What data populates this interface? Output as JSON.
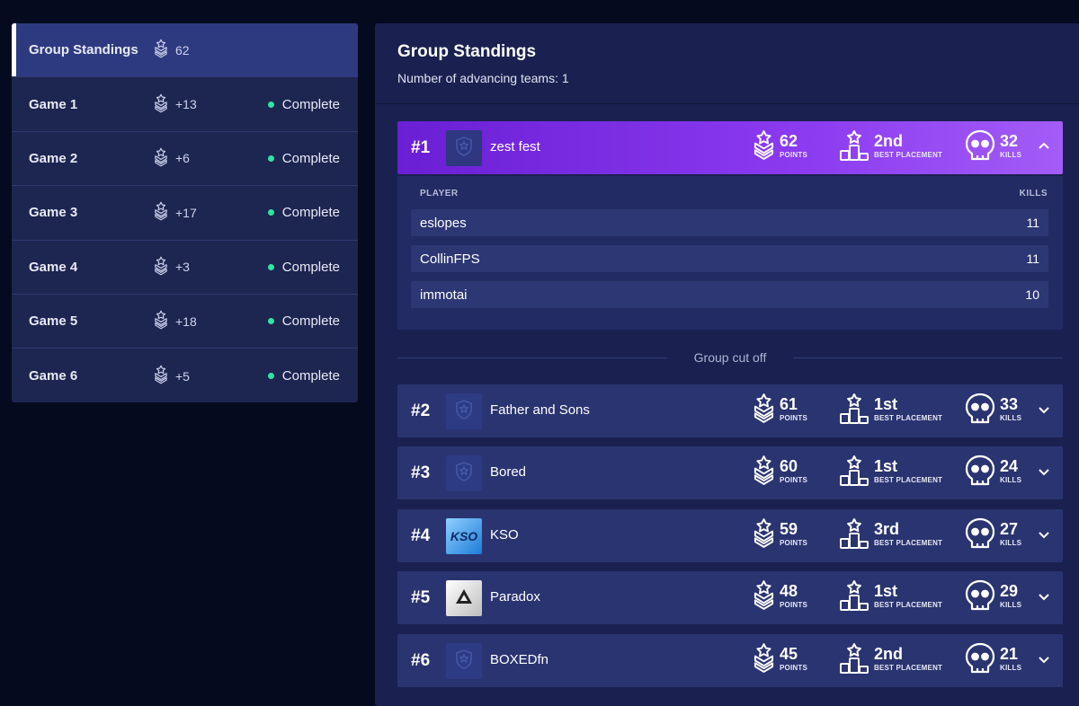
{
  "sidebar": {
    "items": [
      {
        "name": "Group Standings",
        "points": "62",
        "status": ""
      },
      {
        "name": "Game 1",
        "points": "+13",
        "status": "Complete"
      },
      {
        "name": "Game 2",
        "points": "+6",
        "status": "Complete"
      },
      {
        "name": "Game 3",
        "points": "+17",
        "status": "Complete"
      },
      {
        "name": "Game 4",
        "points": "+3",
        "status": "Complete"
      },
      {
        "name": "Game 5",
        "points": "+18",
        "status": "Complete"
      },
      {
        "name": "Game 6",
        "points": "+5",
        "status": "Complete"
      }
    ]
  },
  "main": {
    "title": "Group Standings",
    "subtitle": "Number of advancing teams: 1",
    "cutoff_label": "Group cut off",
    "labels": {
      "points": "POINTS",
      "best_placement": "BEST PLACEMENT",
      "kills": "KILLS",
      "player_header": "PLAYER",
      "kills_header": "KILLS"
    },
    "teams": [
      {
        "rank": "#1",
        "name": "zest fest",
        "points": "62",
        "placement": "2nd",
        "kills": "32",
        "logo": "placeholder"
      },
      {
        "rank": "#2",
        "name": "Father and Sons",
        "points": "61",
        "placement": "1st",
        "kills": "33",
        "logo": "placeholder"
      },
      {
        "rank": "#3",
        "name": "Bored",
        "points": "60",
        "placement": "1st",
        "kills": "24",
        "logo": "placeholder"
      },
      {
        "rank": "#4",
        "name": "KSO",
        "points": "59",
        "placement": "3rd",
        "kills": "27",
        "logo": "kso",
        "logo_text": "KSO"
      },
      {
        "rank": "#5",
        "name": "Paradox",
        "points": "48",
        "placement": "1st",
        "kills": "29",
        "logo": "paradox"
      },
      {
        "rank": "#6",
        "name": "BOXEDfn",
        "points": "45",
        "placement": "2nd",
        "kills": "21",
        "logo": "placeholder"
      }
    ],
    "players": [
      {
        "name": "eslopes",
        "kills": "11"
      },
      {
        "name": "CollinFPS",
        "kills": "11"
      },
      {
        "name": "immotai",
        "kills": "10"
      }
    ]
  },
  "colors": {
    "background": "#050b1e",
    "panel": "#1a2150",
    "row": "#2a3470",
    "highlight_start": "#6a1fd4",
    "highlight_end": "#a35cf6",
    "status_dot": "#2ee6a0"
  },
  "icons": {
    "points": "points-chevron-star-icon",
    "placement": "podium-star-icon",
    "kills": "skull-icon",
    "expand": "chevron-down-icon",
    "collapse": "chevron-up-icon"
  }
}
